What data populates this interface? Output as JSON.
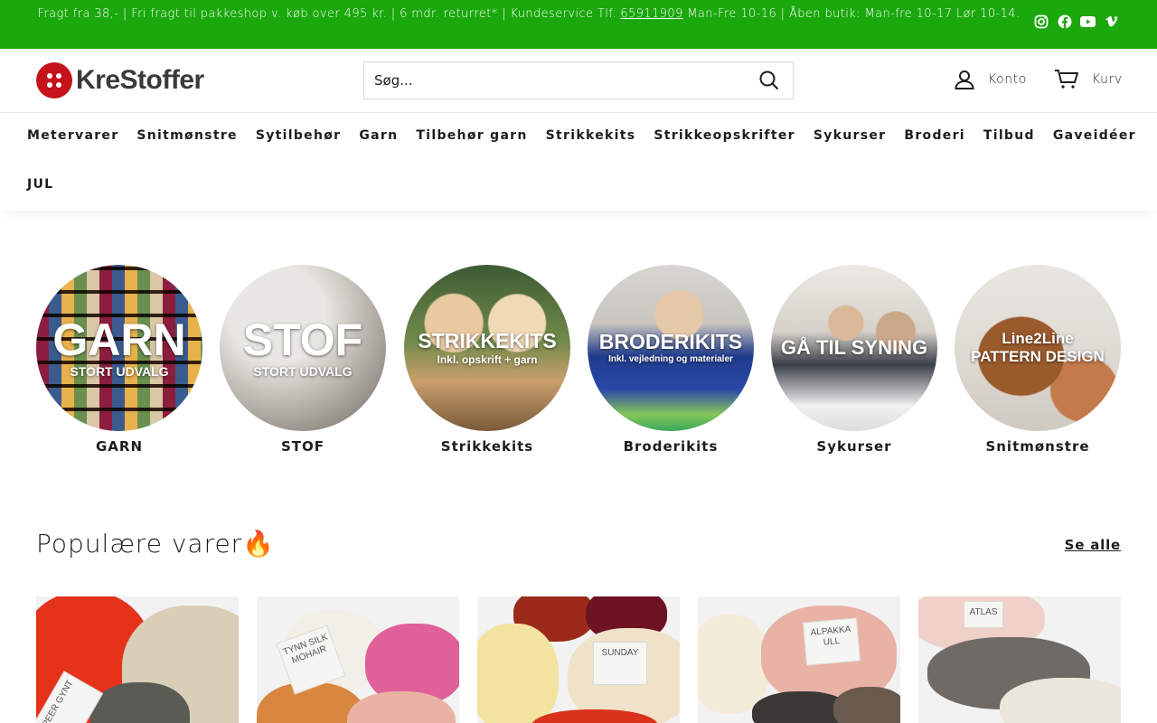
{
  "announcement": {
    "text_before": "Fragt fra 38,- | Fri fragt til pakkeshop v. køb over 495 kr. | 6 mdr. returret* | Kundeservice Tlf. ",
    "phone": "65911909",
    "text_after": " Man-Fre 10-16 | Åben butik: Man-fre 10-17 Lør 10-14."
  },
  "social": [
    "instagram-icon",
    "facebook-icon",
    "youtube-icon",
    "vimeo-icon"
  ],
  "header": {
    "logo_text": "KreStoffer",
    "search_placeholder": "Søg...",
    "account_label": "Konto",
    "cart_label": "Kurv"
  },
  "nav": {
    "row1": [
      "Metervarer",
      "Snitmønstre",
      "Sytilbehør",
      "Garn",
      "Tilbehør garn",
      "Strikkekits",
      "Strikkeopskrifter",
      "Sykurser",
      "Broderi",
      "Tilbud",
      "Gaveidéer"
    ],
    "row2": [
      "JUL"
    ]
  },
  "categories": [
    {
      "label": "GARN",
      "overlay_big": "GARN",
      "overlay_small": "STORT UDVALG"
    },
    {
      "label": "STOF",
      "overlay_big": "STOF",
      "overlay_small": "STORT UDVALG"
    },
    {
      "label": "Strikkekits",
      "overlay_big": "STRIKKEKITS",
      "overlay_small": "Inkl. opskrift + garn"
    },
    {
      "label": "Broderikits",
      "overlay_big": "BRODERIKITS",
      "overlay_small": "Inkl. vejledning og materialer"
    },
    {
      "label": "Sykurser",
      "overlay_big": "GÅ TIL SYNING",
      "overlay_small": ""
    },
    {
      "label": "Snitmønstre",
      "overlay_big": "Line2Line",
      "overlay_small": "PATTERN DESIGN"
    }
  ],
  "popular": {
    "title": "Populære varer🔥",
    "see_all": "Se alle"
  },
  "products": [
    {
      "band_text": "PEER GYNT"
    },
    {
      "band_text": "TYNN SILK MOHAIR"
    },
    {
      "band_text": "SUNDAY"
    },
    {
      "band_text": "ALPAKKA ULL"
    },
    {
      "band_text": "ATLAS"
    }
  ],
  "colors": {
    "announcement_bg": "#1aa80d",
    "logo_red": "#c4131a",
    "text": "#1c1d1d"
  }
}
